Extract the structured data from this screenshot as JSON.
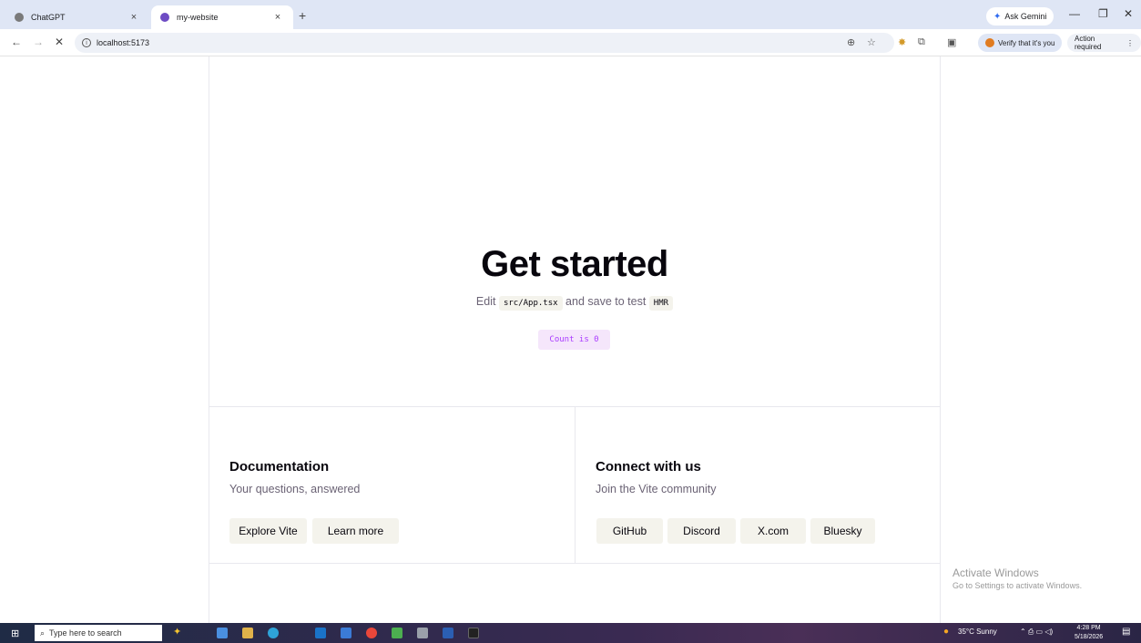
{
  "browser": {
    "tabs": [
      {
        "title": "ChatGPT",
        "active": false
      },
      {
        "title": "my-website",
        "active": true
      }
    ],
    "new_tab": "+",
    "close_glyph": "×",
    "ask_gemini": "Ask Gemini",
    "address": "localhost:5173",
    "verify_label": "Verify that it's you",
    "action_required": "Action required"
  },
  "hero": {
    "title": "Get started",
    "sub_prefix": "Edit",
    "sub_code1": "src/App.tsx",
    "sub_middle": "and save to test",
    "sub_code2": "HMR",
    "counter": "Count is 0"
  },
  "docs": {
    "title": "Documentation",
    "subtitle": "Your questions, answered",
    "buttons": [
      "Explore Vite",
      "Learn more"
    ]
  },
  "social": {
    "title": "Connect with us",
    "subtitle": "Join the Vite community",
    "buttons": [
      "GitHub",
      "Discord",
      "X.com",
      "Bluesky"
    ]
  },
  "watermark": {
    "line1": "Activate Windows",
    "line2": "Go to Settings to activate Windows."
  },
  "taskbar": {
    "search_placeholder": "Type here to search",
    "weather": "35°C  Sunny",
    "time": "4:28 PM",
    "date": "5/18/2026"
  },
  "colors": {
    "accent": "#aa3bff",
    "counter_bg": "#f5e6fb",
    "text_dark": "#08060d",
    "text_muted": "#6b6375"
  }
}
